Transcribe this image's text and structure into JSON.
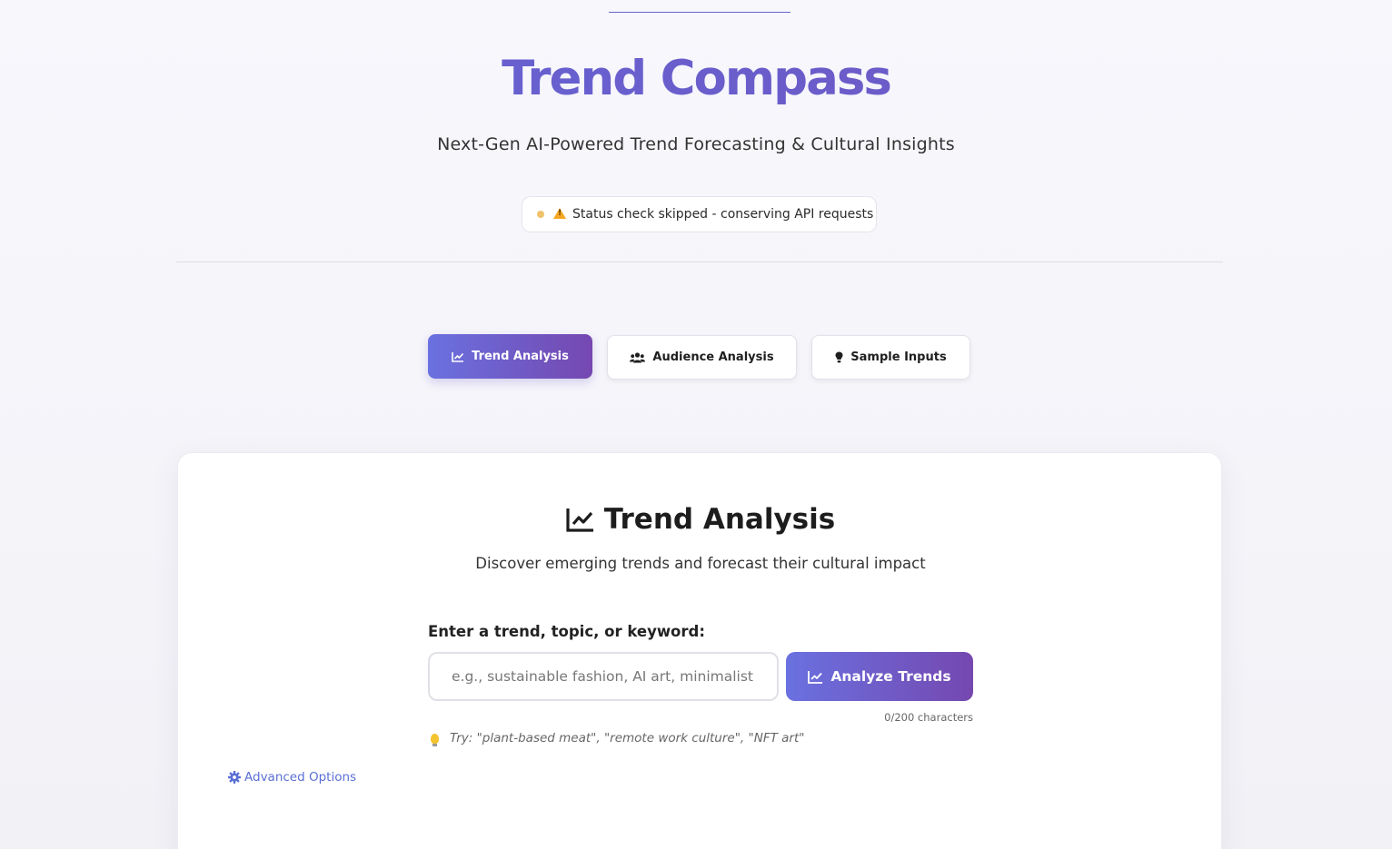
{
  "header": {
    "title": "Trend Compass",
    "subtitle": "Next-Gen AI-Powered Trend Forecasting & Cultural Insights",
    "status_text": "Status check skipped - conserving API requests",
    "status_color": "#f0c26b"
  },
  "tabs": [
    {
      "label": "Trend Analysis",
      "icon": "chart-line-icon",
      "active": true
    },
    {
      "label": "Audience Analysis",
      "icon": "users-icon",
      "active": false
    },
    {
      "label": "Sample Inputs",
      "icon": "lightbulb-icon",
      "active": false
    }
  ],
  "card": {
    "title": "Trend Analysis",
    "title_icon": "chart-line-icon",
    "subtitle": "Discover emerging trends and forecast their cultural impact",
    "field_label": "Enter a trend, topic, or keyword:",
    "input_value": "",
    "input_placeholder": "e.g., sustainable fashion, AI art, minimalist lifestyle",
    "analyze_label": "Analyze Trends",
    "char_count": "0/200 characters",
    "tip": "Try: \"plant-based meat\", \"remote work culture\", \"NFT art\"",
    "advanced_label": "Advanced Options"
  },
  "colors": {
    "accent_start": "#6a71e0",
    "accent_end": "#7548b0",
    "title": "#6a5fc9",
    "link": "#5a6fd6"
  }
}
